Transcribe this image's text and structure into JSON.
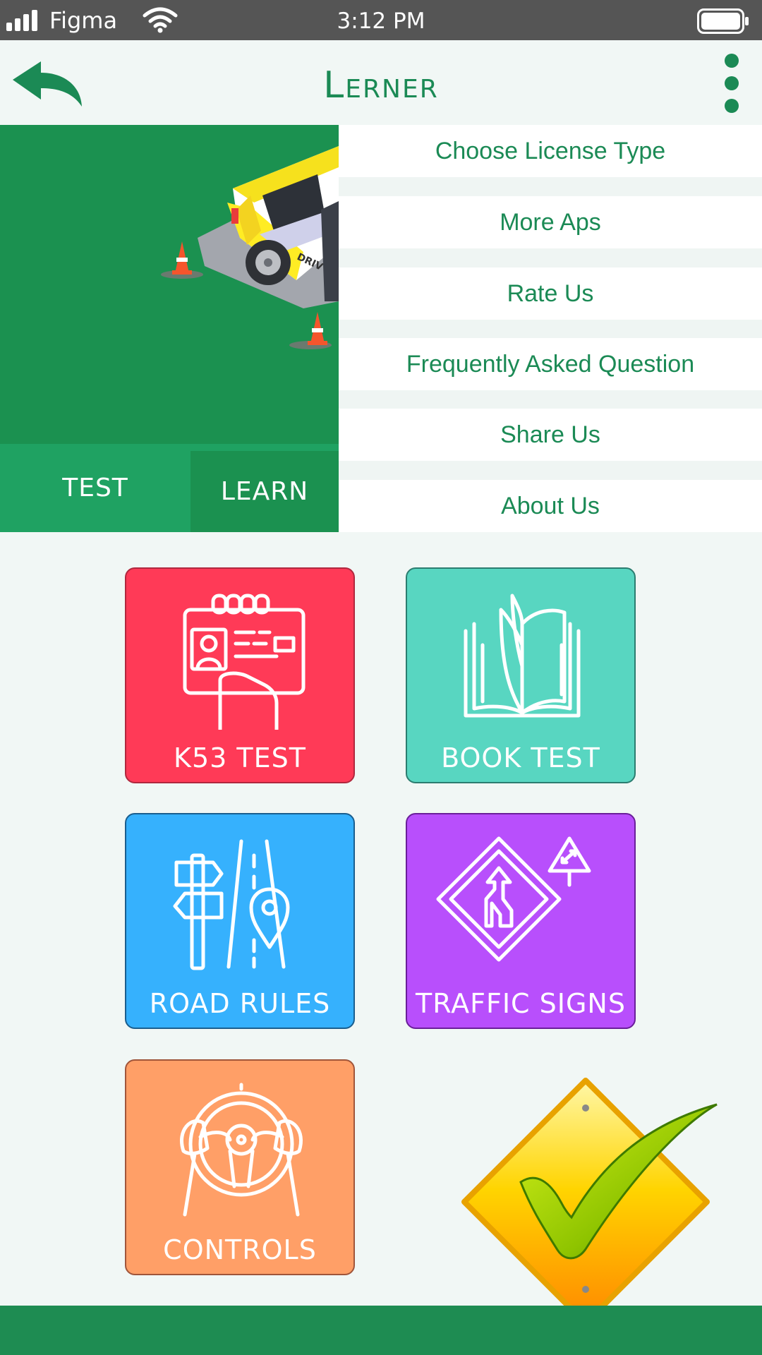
{
  "status_bar": {
    "carrier": "Figma",
    "time": "3:12 PM",
    "icons": [
      "signal-icon",
      "wifi-icon",
      "battery-icon"
    ]
  },
  "header": {
    "title": "Lerner",
    "back_icon": "back-arrow-icon",
    "more_icon": "more-vertical-icon"
  },
  "tabs": [
    {
      "label": "TEST"
    },
    {
      "label": "LEARN",
      "selected": true
    }
  ],
  "menu": {
    "items": [
      {
        "label": "Choose License Type"
      },
      {
        "label": "More Aps"
      },
      {
        "label": "Rate Us"
      },
      {
        "label": "Frequently Asked Question"
      },
      {
        "label": "Share Us"
      },
      {
        "label": "About Us"
      }
    ]
  },
  "tiles": [
    {
      "label": "K53 TEST",
      "icon": "license-card-icon",
      "color": "#ff3a57"
    },
    {
      "label": "BOOK TEST",
      "icon": "open-book-icon",
      "color": "#58d6c1"
    },
    {
      "label": "ROAD RULES",
      "icon": "road-signpost-icon",
      "color": "#36b1fd"
    },
    {
      "label": "TRAFFIC SIGNS",
      "icon": "traffic-sign-icon",
      "color": "#b84ffc"
    },
    {
      "label": "CONTROLS",
      "icon": "steering-wheel-icon",
      "color": "#ff9f67"
    }
  ],
  "colors": {
    "primary": "#1b8a55",
    "hero": "#1b9150",
    "status_bar": "#555555",
    "background": "#f1f7f5"
  }
}
